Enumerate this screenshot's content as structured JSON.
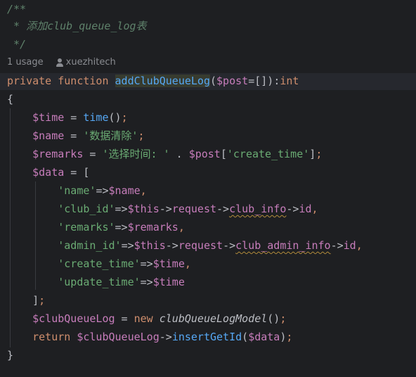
{
  "doc_comment": {
    "open": "/**",
    "text": " * 添加club_queue_log表",
    "close": " */"
  },
  "inlay": {
    "usages": "1 usage",
    "author": "xuezhitech"
  },
  "code": {
    "signature": {
      "kw_private": "private",
      "kw_function": "function",
      "name": "addClubQueueLog",
      "paren_open": "(",
      "param": "$post",
      "default": "=[]",
      "paren_close": ")",
      "colon": ":",
      "return_type": "int"
    },
    "brace_open": "{",
    "brace_close": "}",
    "l_time": {
      "var": "$time",
      "op": " = ",
      "call": "time",
      "args": "()",
      "semi": ";"
    },
    "l_name": {
      "var": "$name",
      "op": " = ",
      "str": "'数据清除'",
      "semi": ";"
    },
    "l_remarks": {
      "var": "$remarks",
      "op": " = ",
      "str": "'选择时间: '",
      "concat": " . ",
      "var2": "$post",
      "lb": "[",
      "key": "'create_time'",
      "rb": "]",
      "semi": ";"
    },
    "l_data": {
      "var": "$data",
      "op": " = ",
      "bracket": "["
    },
    "arr_name": {
      "key": "'name'",
      "arrow": "=>",
      "val": "$name",
      "comma": ","
    },
    "arr_club_id": {
      "key": "'club_id'",
      "arrow": "=>",
      "this": "$this",
      "a1": "->",
      "p1": "request",
      "a2": "->",
      "p2": "club_info",
      "a3": "->",
      "p3": "id",
      "comma": ","
    },
    "arr_remarks": {
      "key": "'remarks'",
      "arrow": "=>",
      "val": "$remarks",
      "comma": ","
    },
    "arr_admin_id": {
      "key": "'admin_id'",
      "arrow": "=>",
      "this": "$this",
      "a1": "->",
      "p1": "request",
      "a2": "->",
      "p2": "club_admin_info",
      "a3": "->",
      "p3": "id",
      "comma": ","
    },
    "arr_create_time": {
      "key": "'create_time'",
      "arrow": "=>",
      "val": "$time",
      "comma": ","
    },
    "arr_update_time": {
      "key": "'update_time'",
      "arrow": "=>",
      "val": "$time"
    },
    "l_close_arr": {
      "bracket": "]",
      "semi": ";"
    },
    "l_model": {
      "var": "$clubQueueLog",
      "op": " = ",
      "kw_new": "new",
      "cls": " clubQueueLogModel",
      "args": "()",
      "semi": ";"
    },
    "l_return": {
      "kw": "return",
      "var": " $clubQueueLog",
      "arrow": "->",
      "call": "insertGetId",
      "paren_open": "(",
      "arg": "$data",
      "paren_close": ")",
      "semi": ";"
    }
  },
  "colors": {
    "background": "#1e1f22",
    "keyword": "#cf8e6d",
    "variable": "#c77dbb",
    "function": "#56a8f5",
    "string": "#6aab73",
    "comment": "#5f826b",
    "text": "#bcbec4"
  },
  "icons": {
    "author": "user-icon"
  }
}
